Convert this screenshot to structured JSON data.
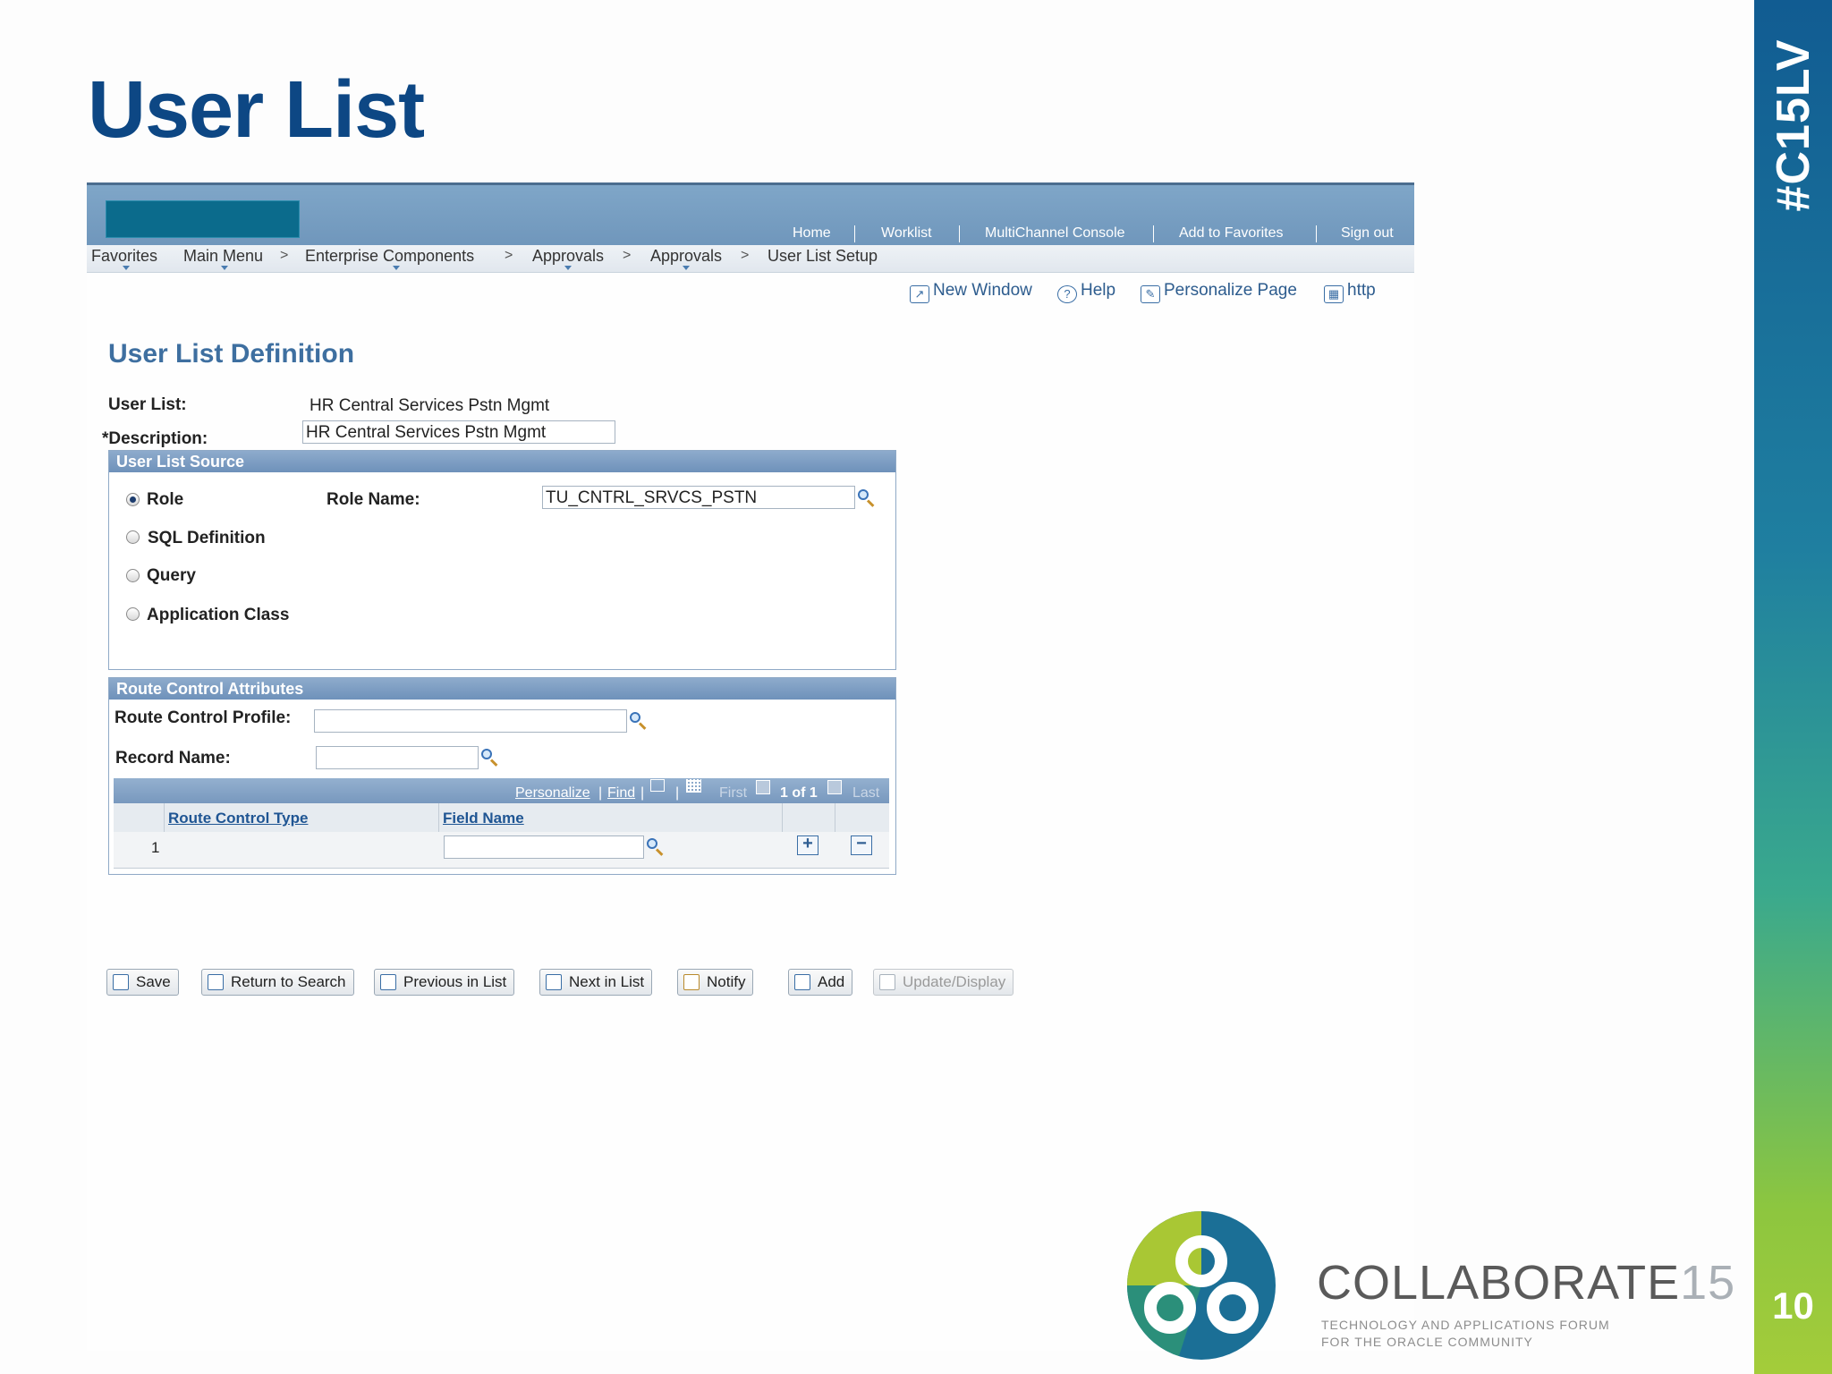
{
  "slide": {
    "title": "User List",
    "hashtag": "#C15LV",
    "page_number": "10",
    "brand": {
      "word": "COLLABORATE",
      "year": "15",
      "tagline_1": "TECHNOLOGY AND APPLICATIONS FORUM",
      "tagline_2": "FOR THE ORACLE COMMUNITY"
    },
    "colors": {
      "title": "#0d4784",
      "band_top": "#115c92",
      "band_bottom": "#a4cc3a"
    }
  },
  "ps": {
    "top_links": [
      "Home",
      "Worklist",
      "MultiChannel Console",
      "Add to Favorites",
      "Sign out"
    ],
    "breadcrumb": {
      "favorites": "Favorites",
      "main_menu": "Main Menu",
      "enterprise_components": "Enterprise Components",
      "approvals_1": "Approvals",
      "approvals_2": "Approvals",
      "current": "User List Setup",
      "separator": ">"
    },
    "utility": {
      "new_window": "New Window",
      "help": "Help",
      "personalize_page": "Personalize Page",
      "http": "http"
    },
    "page_title": "User List Definition",
    "user_list_label": "User List:",
    "user_list_value": "HR Central Services Pstn Mgmt",
    "description_label": "*Description:",
    "description_value": "HR Central Services Pstn Mgmt",
    "source": {
      "header": "User List Source",
      "options": [
        "Role",
        "SQL Definition",
        "Query",
        "Application Class"
      ],
      "selected": "Role",
      "role_name_label": "Role Name:",
      "role_name_value": "TU_CNTRL_SRVCS_PSTN"
    },
    "route": {
      "header": "Route Control Attributes",
      "profile_label": "Route Control Profile:",
      "profile_value": "",
      "record_label": "Record Name:",
      "record_value": "",
      "grid": {
        "personalize": "Personalize",
        "find": "Find",
        "first": "First",
        "count": "1 of 1",
        "last": "Last",
        "columns": [
          "Route Control Type",
          "Field Name"
        ],
        "rows": [
          {
            "num": "1",
            "route_control_type": "",
            "field_name": ""
          }
        ]
      }
    },
    "buttons": {
      "save": "Save",
      "return_to_search": "Return to Search",
      "previous_in_list": "Previous in List",
      "next_in_list": "Next in List",
      "notify": "Notify",
      "add": "Add",
      "update_display": "Update/Display"
    }
  }
}
